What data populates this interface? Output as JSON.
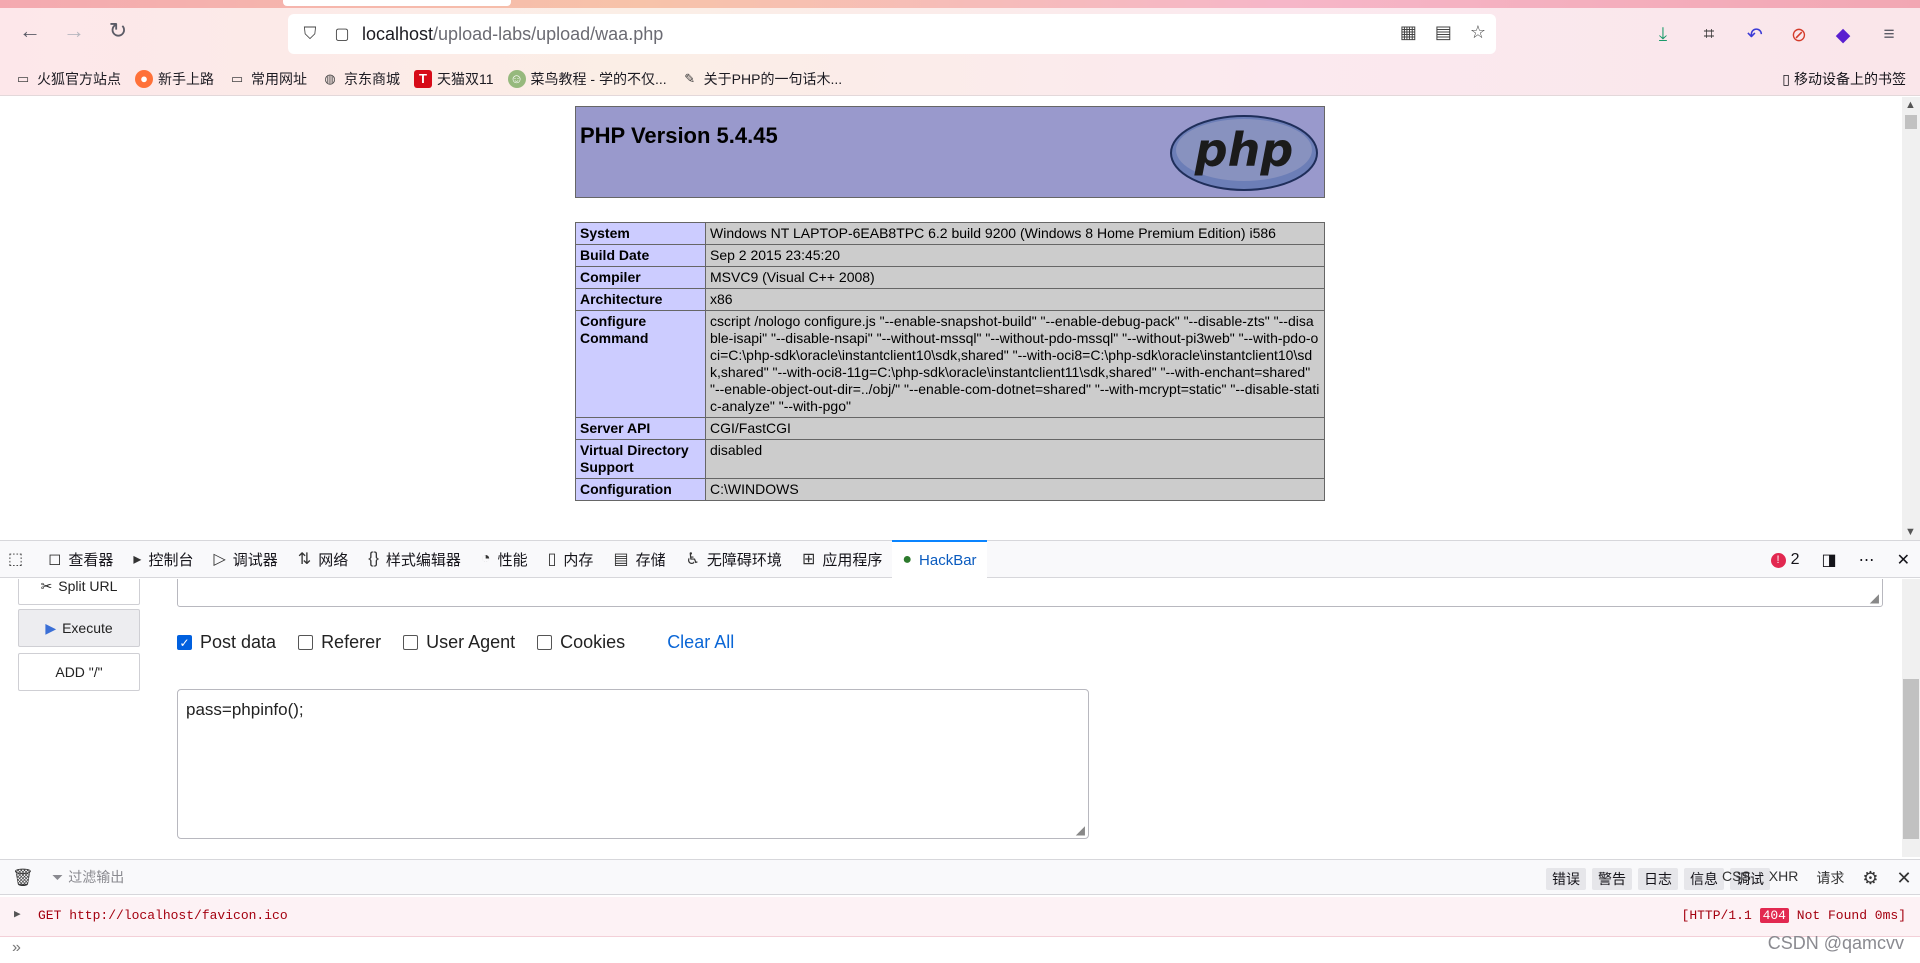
{
  "browser": {
    "url_host": "localhost",
    "url_path": "/upload-labs/upload/waa.php",
    "bookmarks": [
      {
        "label": "火狐官方站点",
        "icon": "folder-icon"
      },
      {
        "label": "新手上路",
        "icon": "firefox-icon"
      },
      {
        "label": "常用网址",
        "icon": "folder-icon"
      },
      {
        "label": "京东商城",
        "icon": "globe-icon"
      },
      {
        "label": "天猫双11",
        "icon": "tmall-icon"
      },
      {
        "label": "菜鸟教程 - 学的不仅...",
        "icon": "runoob-icon"
      },
      {
        "label": "关于PHP的一句话木...",
        "icon": "pen-icon"
      }
    ],
    "mobile_bookmarks": "移动设备上的书签"
  },
  "phpinfo": {
    "title": "PHP Version 5.4.45",
    "rows": [
      {
        "key": "System",
        "value": "Windows NT LAPTOP-6EAB8TPC 6.2 build 9200 (Windows 8 Home Premium Edition) i586"
      },
      {
        "key": "Build Date",
        "value": "Sep 2 2015 23:45:20"
      },
      {
        "key": "Compiler",
        "value": "MSVC9 (Visual C++ 2008)"
      },
      {
        "key": "Architecture",
        "value": "x86"
      },
      {
        "key": "Configure Command",
        "value": "cscript /nologo configure.js \"--enable-snapshot-build\" \"--enable-debug-pack\" \"--disable-zts\" \"--disable-isapi\" \"--disable-nsapi\" \"--without-mssql\" \"--without-pdo-mssql\" \"--without-pi3web\" \"--with-pdo-oci=C:\\php-sdk\\oracle\\instantclient10\\sdk,shared\" \"--with-oci8=C:\\php-sdk\\oracle\\instantclient10\\sdk,shared\" \"--with-oci8-11g=C:\\php-sdk\\oracle\\instantclient11\\sdk,shared\" \"--with-enchant=shared\" \"--enable-object-out-dir=../obj/\" \"--enable-com-dotnet=shared\" \"--with-mcrypt=static\" \"--disable-static-analyze\" \"--with-pgo\""
      },
      {
        "key": "Server API",
        "value": "CGI/FastCGI"
      },
      {
        "key": "Virtual Directory Support",
        "value": "disabled"
      },
      {
        "key": "Configuration",
        "value": "C:\\WINDOWS"
      }
    ]
  },
  "devtools": {
    "tabs": [
      {
        "label": "查看器",
        "icon": "inspector-icon"
      },
      {
        "label": "控制台",
        "icon": "console-icon"
      },
      {
        "label": "调试器",
        "icon": "debugger-icon"
      },
      {
        "label": "网络",
        "icon": "network-icon"
      },
      {
        "label": "样式编辑器",
        "icon": "style-editor-icon"
      },
      {
        "label": "性能",
        "icon": "performance-icon"
      },
      {
        "label": "内存",
        "icon": "memory-icon"
      },
      {
        "label": "存储",
        "icon": "storage-icon"
      },
      {
        "label": "无障碍环境",
        "icon": "accessibility-icon"
      },
      {
        "label": "应用程序",
        "icon": "application-icon"
      },
      {
        "label": "HackBar",
        "icon": "hackbar-icon"
      }
    ],
    "error_count": "2"
  },
  "hackbar": {
    "split_url": "Split URL",
    "execute": "Execute",
    "add_slash": "ADD \"/\"",
    "checkboxes": [
      {
        "label": "Post data",
        "checked": true
      },
      {
        "label": "Referer",
        "checked": false
      },
      {
        "label": "User Agent",
        "checked": false
      },
      {
        "label": "Cookies",
        "checked": false
      }
    ],
    "clear_all": "Clear All",
    "post_body": "pass=phpinfo();"
  },
  "console": {
    "filter_placeholder": "过滤输出",
    "levels": [
      "错误",
      "警告",
      "日志",
      "信息",
      "调试"
    ],
    "extra": [
      "CSS",
      "XHR",
      "请求"
    ],
    "message": "GET http://localhost/favicon.ico",
    "status_prefix": "[HTTP/1.1",
    "status_code": "404",
    "status_suffix": "Not Found 0ms]"
  },
  "watermark": "CSDN @qamcvv"
}
